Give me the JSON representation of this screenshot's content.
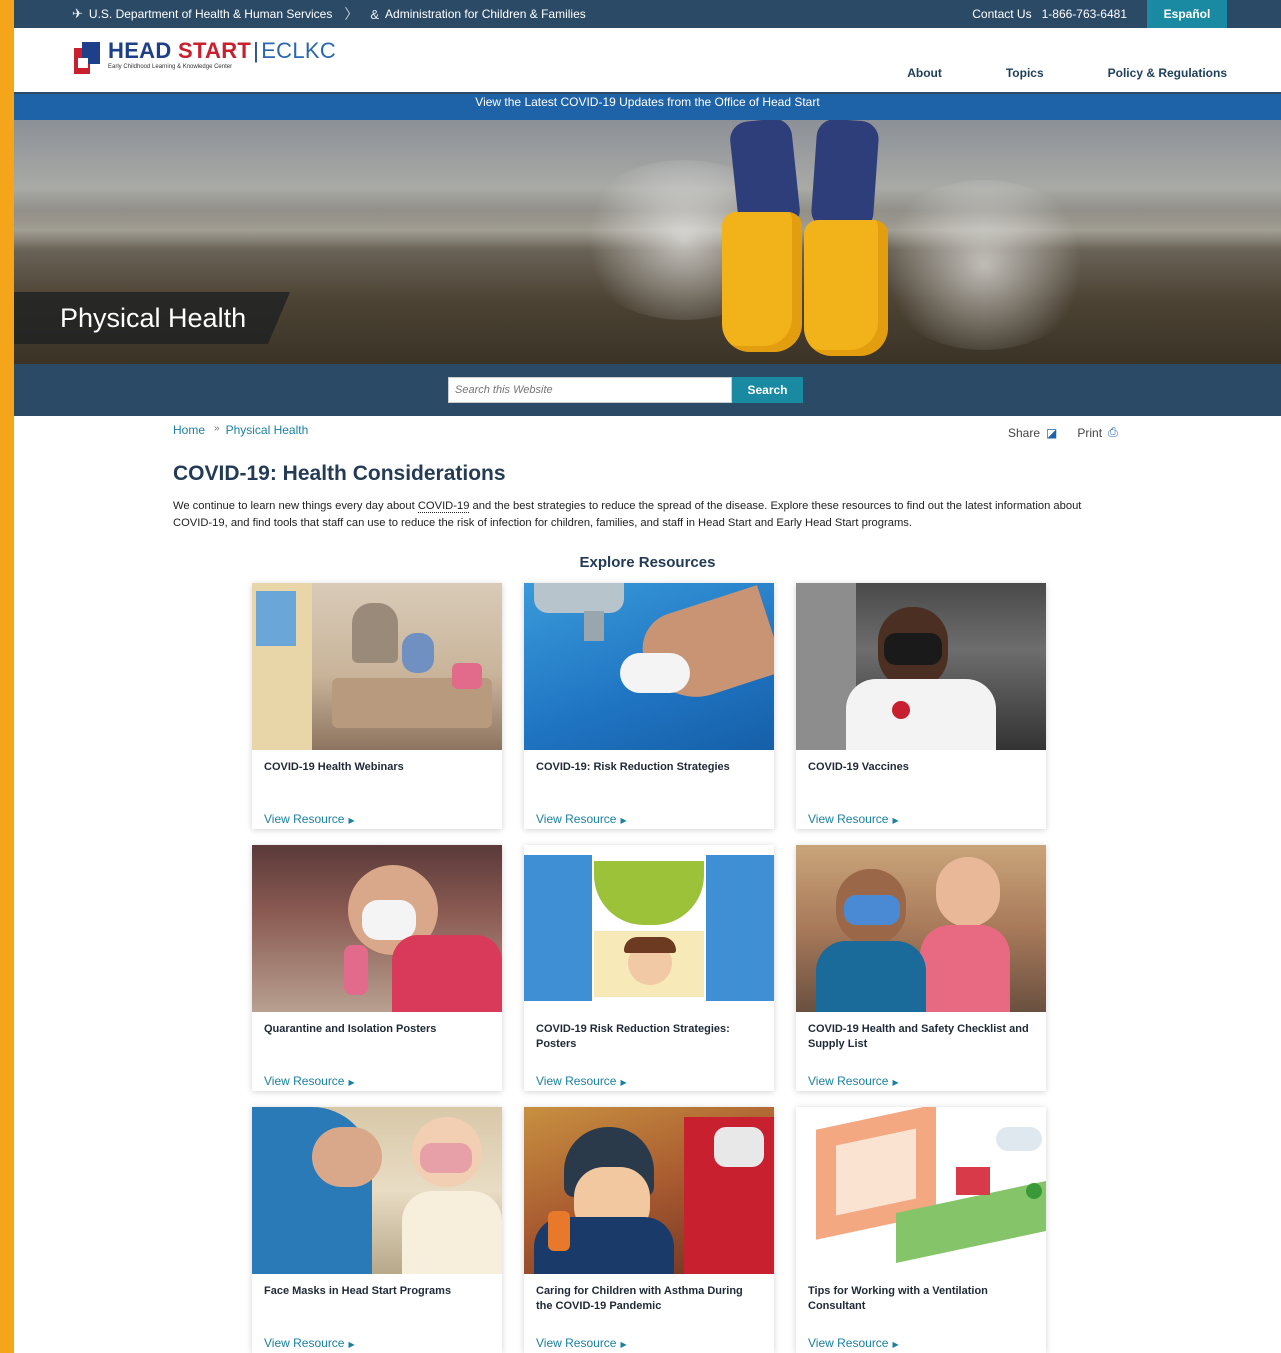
{
  "gov_bar": {
    "agency": "U.S. Department of Health & Human Services",
    "office": "Administration for Children & Families",
    "contact": "Contact Us",
    "phone": "1-866-763-6481",
    "language": "Español"
  },
  "header": {
    "logo_head": "HEAD",
    "logo_start": "START",
    "logo_eclkc": "ECLKC",
    "logo_subtitle": "Early Childhood Learning & Knowledge Center",
    "nav": [
      "About",
      "Topics",
      "Policy & Regulations"
    ]
  },
  "covid_banner": "View the Latest COVID-19 Updates from the Office of Head Start",
  "hero": {
    "title": "Physical Health"
  },
  "search": {
    "placeholder": "Search this Website",
    "button": "Search"
  },
  "breadcrumbs": [
    "Home",
    "Physical Health"
  ],
  "tools": {
    "share": "Share",
    "print": "Print"
  },
  "page": {
    "title": "COVID-19: Health Considerations",
    "intro_before": "We continue to learn new things every day about ",
    "intro_link": "COVID-19",
    "intro_after": " and the best strategies to reduce the spread of the disease. Explore these resources to find out the latest information about COVID-19, and find tools that staff can use to reduce the risk of infection for children, families, and staff in Head Start and Early Head Start programs.",
    "explore_heading": "Explore Resources"
  },
  "cards": [
    {
      "title": "COVID-19 Health Webinars",
      "link": "View Resource"
    },
    {
      "title": "COVID-19: Risk Reduction Strategies",
      "link": "View Resource"
    },
    {
      "title": "COVID-19 Vaccines",
      "link": "View Resource"
    },
    {
      "title": "Quarantine and Isolation Posters",
      "link": "View Resource"
    },
    {
      "title": "COVID-19 Risk Reduction Strategies: Posters",
      "link": "View Resource"
    },
    {
      "title": "COVID-19 Health and Safety Checklist and Supply List",
      "link": "View Resource"
    },
    {
      "title": "Face Masks in Head Start Programs",
      "link": "View Resource"
    },
    {
      "title": "Caring for Children with Asthma During the COVID-19 Pandemic",
      "link": "View Resource"
    },
    {
      "title": "Tips for Working with a Ventilation Consultant",
      "link": "View Resource"
    }
  ],
  "colors": {
    "accent_stripe": "#f5a519",
    "gov_bar": "#2b4a66",
    "covid_banner": "#1e62a8",
    "teal_button": "#1a8aa3",
    "link": "#1a7fa0"
  }
}
